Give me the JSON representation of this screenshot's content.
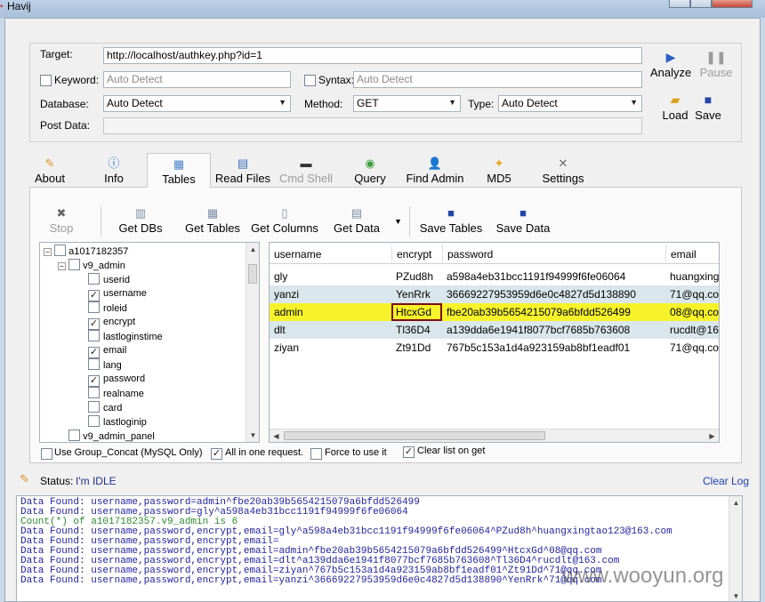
{
  "window": {
    "title": "Havij"
  },
  "target": {
    "label": "Target:",
    "url": "http://localhost/authkey.php?id=1",
    "keyword_label": "Keyword:",
    "keyword_placeholder": "Auto Detect",
    "syntax_label": "Syntax:",
    "syntax_placeholder": "Auto Detect",
    "database_label": "Database:",
    "database_value": "Auto Detect",
    "method_label": "Method:",
    "method_value": "GET",
    "type_label": "Type:",
    "type_value": "Auto Detect",
    "postdata_label": "Post Data:"
  },
  "actions": {
    "analyze": "Analyze",
    "pause": "Pause",
    "load": "Load",
    "save": "Save"
  },
  "tabs": [
    {
      "label": "About",
      "icon": "about-icon"
    },
    {
      "label": "Info",
      "icon": "info-icon"
    },
    {
      "label": "Tables",
      "icon": "tables-icon",
      "active": true
    },
    {
      "label": "Read Files",
      "icon": "read-files-icon"
    },
    {
      "label": "Cmd Shell",
      "icon": "cmd-shell-icon",
      "disabled": true
    },
    {
      "label": "Query",
      "icon": "query-icon"
    },
    {
      "label": "Find Admin",
      "icon": "find-admin-icon"
    },
    {
      "label": "MD5",
      "icon": "md5-icon"
    },
    {
      "label": "Settings",
      "icon": "settings-icon"
    }
  ],
  "toolbar": {
    "stop": "Stop",
    "get_dbs": "Get DBs",
    "get_tables": "Get Tables",
    "get_columns": "Get Columns",
    "get_data": "Get Data",
    "save_tables": "Save Tables",
    "save_data": "Save Data"
  },
  "tree": {
    "database": "a1017182357",
    "table": "v9_admin",
    "columns": [
      {
        "name": "userid",
        "checked": false
      },
      {
        "name": "username",
        "checked": true
      },
      {
        "name": "roleid",
        "checked": false
      },
      {
        "name": "encrypt",
        "checked": true
      },
      {
        "name": "lastloginstime",
        "checked": false
      },
      {
        "name": "email",
        "checked": true
      },
      {
        "name": "lang",
        "checked": false
      },
      {
        "name": "password",
        "checked": true
      },
      {
        "name": "realname",
        "checked": false
      },
      {
        "name": "card",
        "checked": false
      },
      {
        "name": "lastloginip",
        "checked": false
      }
    ],
    "next_table": "v9_admin_panel"
  },
  "grid": {
    "columns": [
      "username",
      "encrypt",
      "password",
      "email"
    ],
    "rows": [
      [
        "gly",
        "PZud8h",
        "a598a4eb31bcc1191f94999f6fe06064",
        "huangxing"
      ],
      [
        "yanzi",
        "YenRrk",
        "36669227953959d6e0c4827d5d138890",
        "71@qq.co"
      ],
      [
        "admin",
        "HtcxGd",
        "fbe20ab39b5654215079a6bfdd526499",
        "08@qq.co"
      ],
      [
        "dlt",
        "Tl36D4",
        "a139dda6e1941f8077bcf7685b763608",
        "rucdlt@16"
      ],
      [
        "ziyan",
        "Zt91Dd",
        "767b5c153a1d4a923159ab8bf1eadf01",
        "71@qq.co"
      ]
    ],
    "selected_row": 2
  },
  "options": {
    "group_concat": {
      "label": "Use Group_Concat (MySQL Only)",
      "checked": false
    },
    "all_in_one": {
      "label": "All in one request.",
      "checked": true
    },
    "force": {
      "label": "Force to use it",
      "checked": false
    },
    "clear_list": {
      "label": "Clear list on get",
      "checked": true
    }
  },
  "status": {
    "label": "Status:",
    "value": "I'm IDLE",
    "clear_log": "Clear Log"
  },
  "log": [
    {
      "text": "Data Found: username,password=admin^fbe20ab39b5654215079a6bfdd526499",
      "color": "#1f1f9f"
    },
    {
      "text": "Data Found: username,password=gly^a598a4eb31bcc1191f94999f6fe06064",
      "color": "#1f1f9f"
    },
    {
      "text": "Count(*) of a1017182357.v9_admin is 6",
      "color": "#2e8b2e"
    },
    {
      "text": "Data Found: username,password,encrypt,email=gly^a598a4eb31bcc1191f94999f6fe06064^PZud8h^huangxingtao123@163.com",
      "color": "#1f1f9f"
    },
    {
      "text": "Data Found: username,password,encrypt,email=",
      "color": "#1f1f9f"
    },
    {
      "text": "Data Found: username,password,encrypt,email=admin^fbe20ab39b5654215079a6bfdd526499^HtcxGd^08@qq.com",
      "color": "#1f1f9f"
    },
    {
      "text": "Data Found: username,password,encrypt,email=dlt^a139dda6e1941f8077bcf7685b763608^Tl36D4^rucdlt@163.com",
      "color": "#1f1f9f"
    },
    {
      "text": "Data Found: username,password,encrypt,email=ziyan^767b5c153a1d4a923159ab8bf1eadf01^Zt91Dd^71@qq.com",
      "color": "#1f1f9f"
    },
    {
      "text": "Data Found: username,password,encrypt,email=yanzi^36669227953959d6e0c4827d5d138890^YenRrk^71@qq.com",
      "color": "#1f1f9f"
    }
  ],
  "watermark": "www.wooyun.org"
}
